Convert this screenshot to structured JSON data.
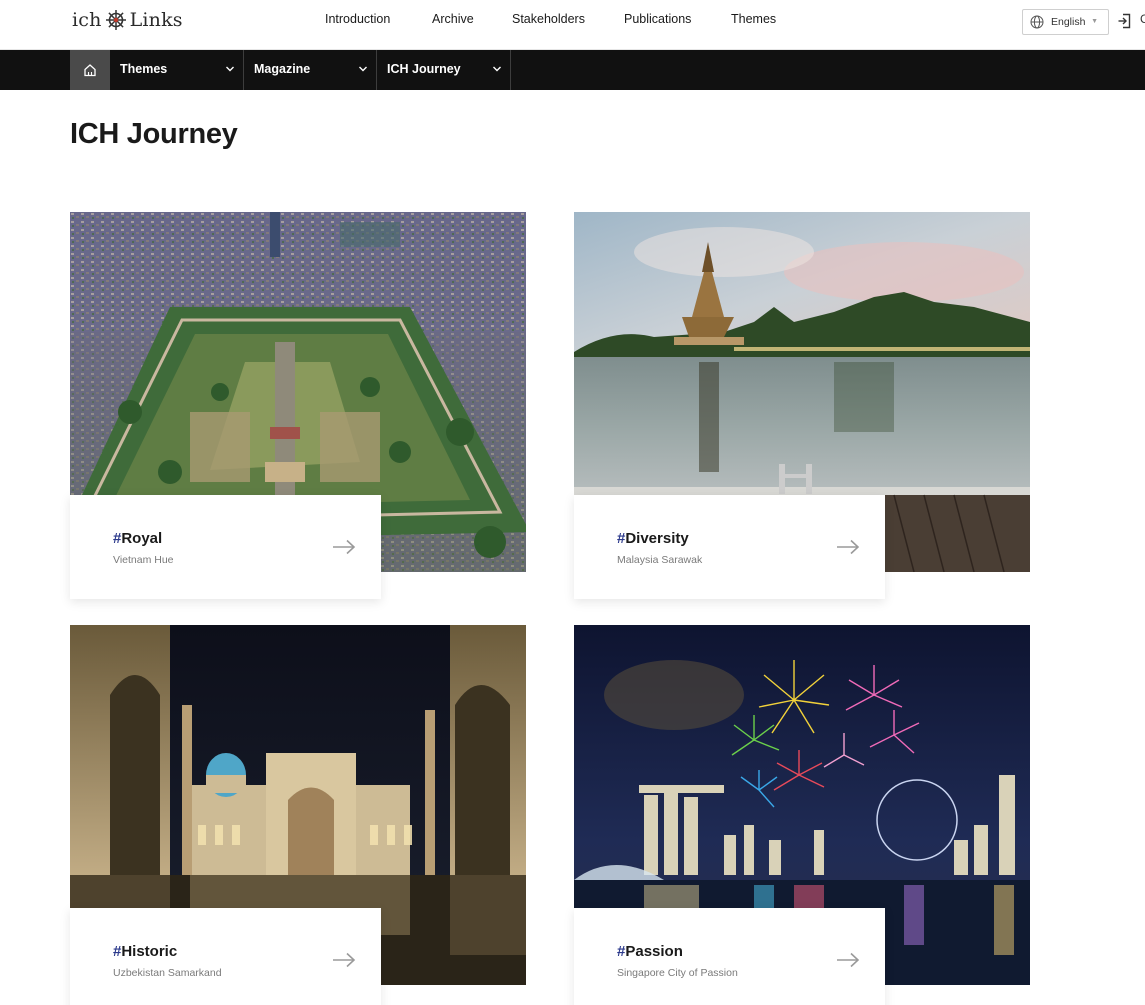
{
  "header": {
    "logo_left": "ich",
    "logo_right": "Links",
    "nav": [
      {
        "label": "Introduction"
      },
      {
        "label": "Archive"
      },
      {
        "label": "Stakeholders"
      },
      {
        "label": "Publications"
      },
      {
        "label": "Themes"
      }
    ],
    "language": "English",
    "edge_glyph": "C"
  },
  "subnav": {
    "items": [
      {
        "label": "Themes"
      },
      {
        "label": "Magazine"
      },
      {
        "label": "ICH Journey"
      }
    ]
  },
  "page": {
    "title": "ICH Journey"
  },
  "cards": [
    {
      "hash": "#",
      "tag": "Royal",
      "place": "Vietnam Hue",
      "image": "aerial-citadel-photo"
    },
    {
      "hash": "#",
      "tag": "Diversity",
      "place": "Malaysia Sarawak",
      "image": "riverside-building-photo"
    },
    {
      "hash": "#",
      "tag": "Historic",
      "place": "Uzbekistan Samarkand",
      "image": "madrasa-night-photo"
    },
    {
      "hash": "#",
      "tag": "Passion",
      "place": "Singapore City of Passion",
      "image": "fireworks-skyline-photo"
    }
  ],
  "colors": {
    "accent_hash": "#2c3a8c",
    "subnav_bg": "#111111",
    "home_bg": "#4a4a4a"
  }
}
